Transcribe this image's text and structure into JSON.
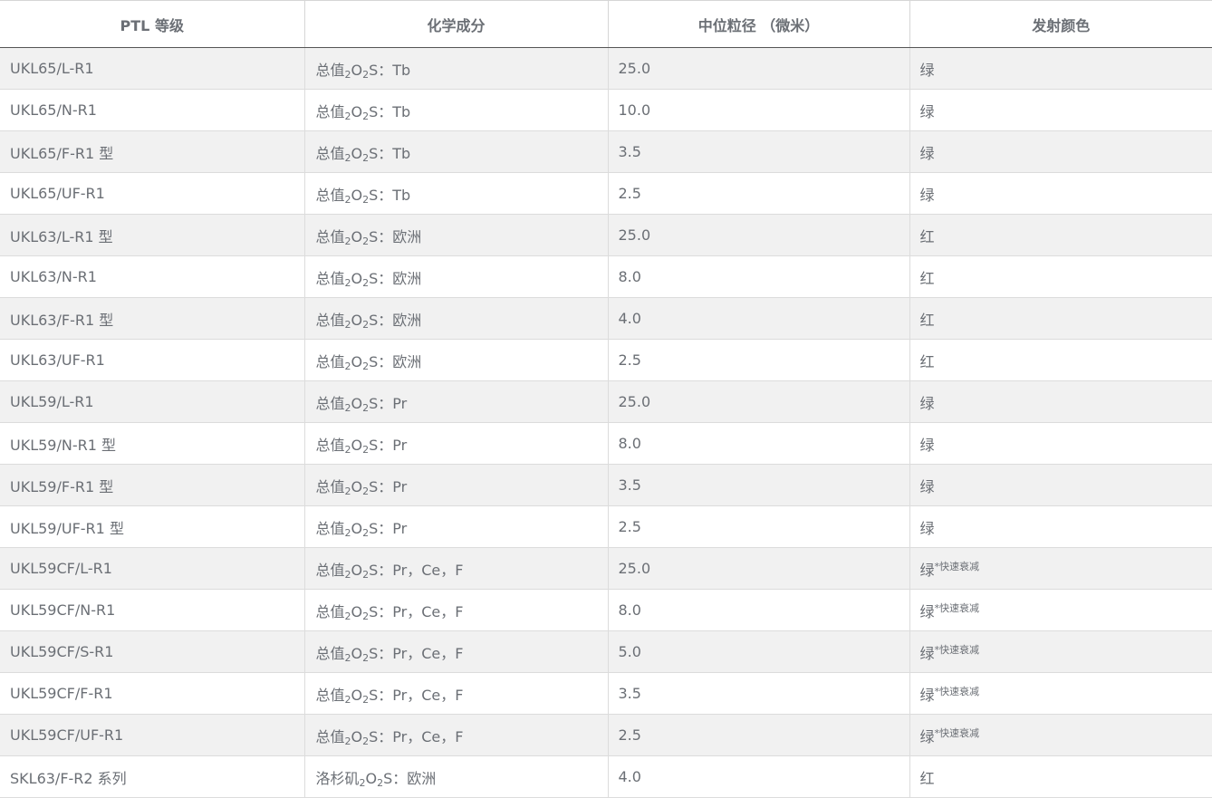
{
  "table": {
    "headers": [
      "PTL 等级",
      "化学成分",
      "中位粒径 （微米）",
      "发射颜色"
    ],
    "rows": [
      {
        "grade": "UKL65/L-R1",
        "chem_pre": "总值",
        "chem_post": "：Tb",
        "size": "25.0",
        "color": "绿",
        "note": ""
      },
      {
        "grade": "UKL65/N-R1",
        "chem_pre": "总值",
        "chem_post": "：Tb",
        "size": "10.0",
        "color": "绿",
        "note": ""
      },
      {
        "grade": "UKL65/F-R1 型",
        "chem_pre": "总值",
        "chem_post": "：Tb",
        "size": "3.5",
        "color": "绿",
        "note": ""
      },
      {
        "grade": "UKL65/UF-R1",
        "chem_pre": "总值",
        "chem_post": "：Tb",
        "size": "2.5",
        "color": "绿",
        "note": ""
      },
      {
        "grade": "UKL63/L-R1 型",
        "chem_pre": "总值",
        "chem_post": "：欧洲",
        "size": "25.0",
        "color": "红",
        "note": ""
      },
      {
        "grade": "UKL63/N-R1",
        "chem_pre": "总值",
        "chem_post": "：欧洲",
        "size": "8.0",
        "color": "红",
        "note": ""
      },
      {
        "grade": "UKL63/F-R1 型",
        "chem_pre": "总值",
        "chem_post": "：欧洲",
        "size": "4.0",
        "color": "红",
        "note": ""
      },
      {
        "grade": "UKL63/UF-R1",
        "chem_pre": "总值",
        "chem_post": "：欧洲",
        "size": "2.5",
        "color": "红",
        "note": ""
      },
      {
        "grade": "UKL59/L-R1",
        "chem_pre": "总值",
        "chem_post": "：Pr",
        "size": "25.0",
        "color": "绿",
        "note": ""
      },
      {
        "grade": "UKL59/N-R1 型",
        "chem_pre": "总值",
        "chem_post": "：Pr",
        "size": "8.0",
        "color": "绿",
        "note": ""
      },
      {
        "grade": "UKL59/F-R1 型",
        "chem_pre": "总值",
        "chem_post": "：Pr",
        "size": "3.5",
        "color": "绿",
        "note": ""
      },
      {
        "grade": "UKL59/UF-R1 型",
        "chem_pre": "总值",
        "chem_post": "：Pr",
        "size": "2.5",
        "color": "绿",
        "note": ""
      },
      {
        "grade": "UKL59CF/L-R1",
        "chem_pre": "总值",
        "chem_post": "：Pr，Ce，F",
        "size": "25.0",
        "color": "绿",
        "note": "*快速衰减"
      },
      {
        "grade": "UKL59CF/N-R1",
        "chem_pre": "总值",
        "chem_post": "：Pr，Ce，F",
        "size": "8.0",
        "color": "绿",
        "note": "*快速衰减"
      },
      {
        "grade": "UKL59CF/S-R1",
        "chem_pre": "总值",
        "chem_post": "：Pr，Ce，F",
        "size": "5.0",
        "color": "绿",
        "note": "*快速衰减"
      },
      {
        "grade": "UKL59CF/F-R1",
        "chem_pre": "总值",
        "chem_post": "：Pr，Ce，F",
        "size": "3.5",
        "color": "绿",
        "note": "*快速衰减"
      },
      {
        "grade": "UKL59CF/UF-R1",
        "chem_pre": "总值",
        "chem_post": "：Pr，Ce，F",
        "size": "2.5",
        "color": "绿",
        "note": "*快速衰减"
      },
      {
        "grade": "SKL63/F-R2 系列",
        "chem_pre": "洛杉矶",
        "chem_post": "：欧洲",
        "size": "4.0",
        "color": "红",
        "note": ""
      }
    ]
  }
}
